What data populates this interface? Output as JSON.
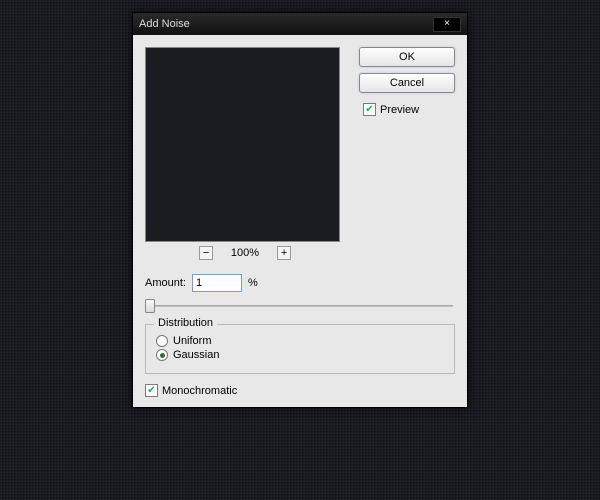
{
  "dialog": {
    "title": "Add Noise",
    "buttons": {
      "ok": "OK",
      "cancel": "Cancel"
    },
    "preview_checkbox": {
      "label": "Preview",
      "checked": true
    },
    "zoom": {
      "level": "100%",
      "minus": "−",
      "plus": "+"
    },
    "amount": {
      "label": "Amount:",
      "value": "1",
      "unit": "%"
    },
    "distribution": {
      "legend": "Distribution",
      "options": {
        "uniform": {
          "label": "Uniform",
          "selected": false
        },
        "gaussian": {
          "label": "Gaussian",
          "selected": true
        }
      }
    },
    "monochromatic": {
      "label": "Monochromatic",
      "checked": true
    }
  }
}
